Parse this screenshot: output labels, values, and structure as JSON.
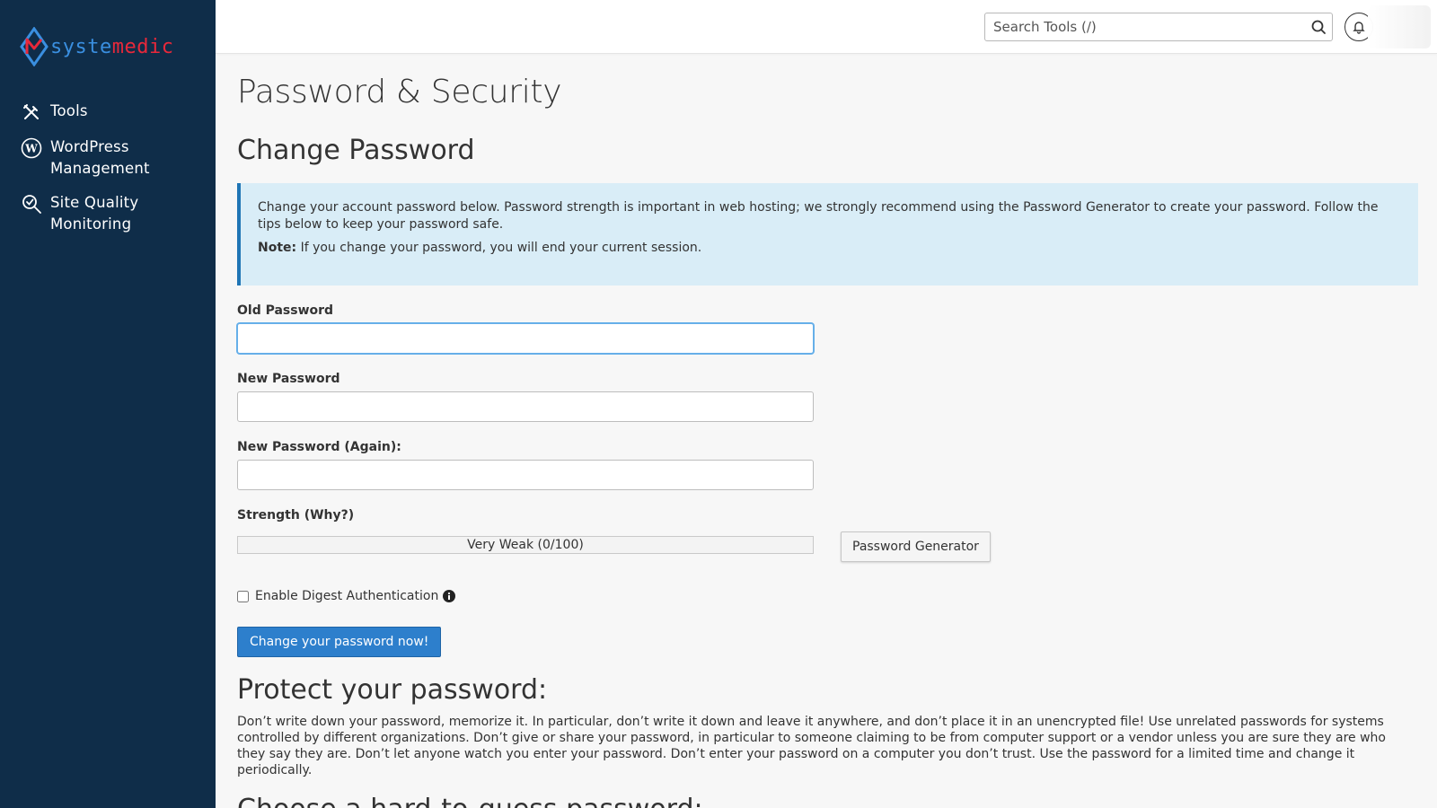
{
  "brand": {
    "part1": "syste",
    "part2": "medic"
  },
  "sidebar": {
    "items": [
      {
        "label_line1": "Tools",
        "label_line2": "",
        "icon": "tools-icon"
      },
      {
        "label_line1": "WordPress",
        "label_line2": "Management",
        "icon": "wordpress-icon"
      },
      {
        "label_line1": "Site Quality",
        "label_line2": "Monitoring",
        "icon": "site-quality-icon"
      }
    ]
  },
  "header": {
    "search_placeholder": "Search Tools (/)"
  },
  "main": {
    "page_title": "Password & Security",
    "section_title": "Change Password",
    "callout_text": "Change your account password below. Password strength is important in web hosting; we strongly recommend using the Password Generator to create your password. Follow the tips below to keep your password safe.",
    "note_label": "Note:",
    "note_text": " If you change your password, you will end your current session.",
    "old_password_label": "Old Password",
    "new_password_label": "New Password",
    "new_password_again_label": "New Password (Again):",
    "strength_label": "Strength (Why?)",
    "strength_text": "Very Weak (0/100)",
    "strength_value": 0,
    "password_generator_label": "Password Generator",
    "digest_label": "Enable Digest Authentication",
    "submit_label": "Change your password now!",
    "protect_title": "Protect your password:",
    "protect_text": "Don’t write down your password, memorize it. In particular, don’t write it down and leave it anywhere, and don’t place it in an unencrypted file! Use unrelated passwords for systems controlled by different organizations. Don’t give or share your password, in particular to someone claiming to be from computer support or a vendor unless you are sure they are who they say they are. Don’t let anyone watch you enter your password. Don’t enter your password on a computer you don’t trust. Use the password for a limited time and change it periodically.",
    "choose_title": "Choose a hard-to-guess password:"
  },
  "colors": {
    "sidebar_bg": "#0f2d49",
    "brand_blue": "#3a8fe0",
    "brand_red": "#e8283a",
    "primary_button": "#2d7fcc",
    "callout_bg": "#d9edf7"
  }
}
